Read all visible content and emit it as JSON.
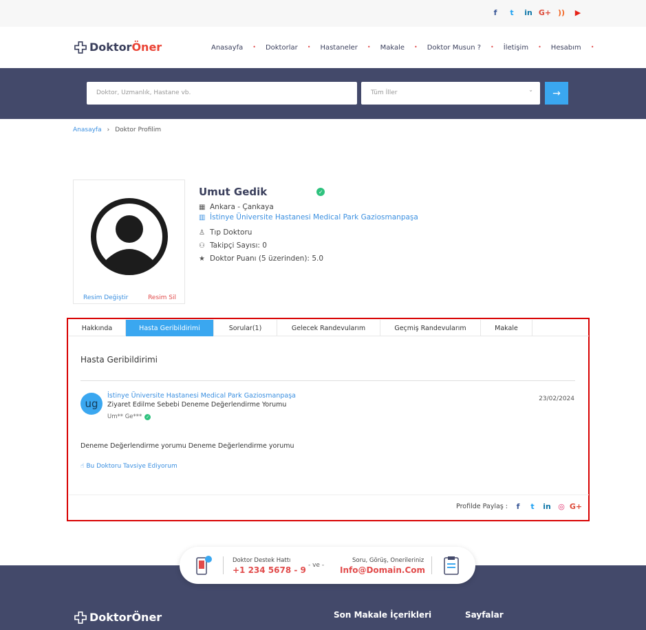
{
  "topbar": {
    "social": [
      {
        "name": "facebook-icon",
        "glyph": "f",
        "color": "#3b5998"
      },
      {
        "name": "twitter-icon",
        "glyph": "t",
        "color": "#1da1f2"
      },
      {
        "name": "linkedin-icon",
        "glyph": "in",
        "color": "#0e76a8"
      },
      {
        "name": "google-plus-icon",
        "glyph": "G+",
        "color": "#dd4b39"
      },
      {
        "name": "rss-icon",
        "glyph": "))",
        "color": "#f26522"
      },
      {
        "name": "youtube-icon",
        "glyph": "▶",
        "color": "#e62117"
      }
    ]
  },
  "brand": {
    "doktor": "Doktor",
    "oner": "Öner"
  },
  "nav": {
    "items": [
      "Anasayfa",
      "Doktorlar",
      "Hastaneler",
      "Makale",
      "Doktor Musun ?",
      "İletişim",
      "Hesabım"
    ]
  },
  "search": {
    "query_placeholder": "Doktor, Uzmanlık, Hastane vb.",
    "city_value": "Tüm İller",
    "submit_glyph": "→"
  },
  "breadcrumb": {
    "home": "Anasayfa",
    "separator": "›",
    "current": "Doktor Profilim"
  },
  "photo": {
    "change": "Resim Değiştir",
    "delete": "Resim Sil"
  },
  "profile": {
    "name": "Umut Gedik",
    "location": "Ankara - Çankaya",
    "hospital": "İstinye Üniversite Hastanesi Medical Park Gaziosmanpaşa",
    "specialty": "Tıp Doktoru",
    "followers": "Takipçi Sayısı: 0",
    "rating": "Doktor Puanı (5 üzerinden): 5.0"
  },
  "tabs": [
    {
      "label": "Hakkında",
      "active": false
    },
    {
      "label": "Hasta Geribildirimi",
      "active": true
    },
    {
      "label": "Sorular(1)",
      "active": false
    },
    {
      "label": "Gelecek Randevularım",
      "active": false
    },
    {
      "label": "Geçmiş Randevularım",
      "active": false
    },
    {
      "label": "Makale",
      "active": false
    }
  ],
  "feedback": {
    "section_title": "Hasta Geribildirimi",
    "initials": "ug",
    "hospital": "İstinye Üniversite Hastanesi Medical Park Gaziosmanpaşa",
    "reason": "Ziyaret Edilme Sebebi Deneme Değerlendirme Yorumu",
    "user": "Um** Ge***",
    "date": "23/02/2024",
    "text": "Deneme Değerlendirme yorumu Deneme Değerlendirme yorumu",
    "recommend": "Bu Doktoru Tavsiye Ediyorum"
  },
  "share": {
    "label": "Profilde Paylaş :",
    "icons": [
      {
        "name": "facebook-icon",
        "glyph": "f",
        "color": "#3b5998"
      },
      {
        "name": "twitter-icon",
        "glyph": "t",
        "color": "#1da1f2"
      },
      {
        "name": "linkedin-icon",
        "glyph": "in",
        "color": "#0e76a8"
      },
      {
        "name": "instagram-icon",
        "glyph": "◎",
        "color": "#e1306c"
      },
      {
        "name": "google-plus-icon",
        "glyph": "G+",
        "color": "#dd4b39"
      }
    ]
  },
  "support": {
    "phone_label": "Doktor Destek Hattı",
    "phone": "+1 234 5678 - 9",
    "or": "- ve -",
    "mail_label": "Soru, Görüş, Onerileriniz",
    "mail": "Info@Domain.Com"
  },
  "footer": {
    "heading1": "Son Makale İçerikleri",
    "heading2": "Sayfalar"
  },
  "colors": {
    "accent": "#3aa7f0",
    "brand_red": "#ea4335",
    "navy": "#43496a",
    "highlight": "#d80000"
  }
}
